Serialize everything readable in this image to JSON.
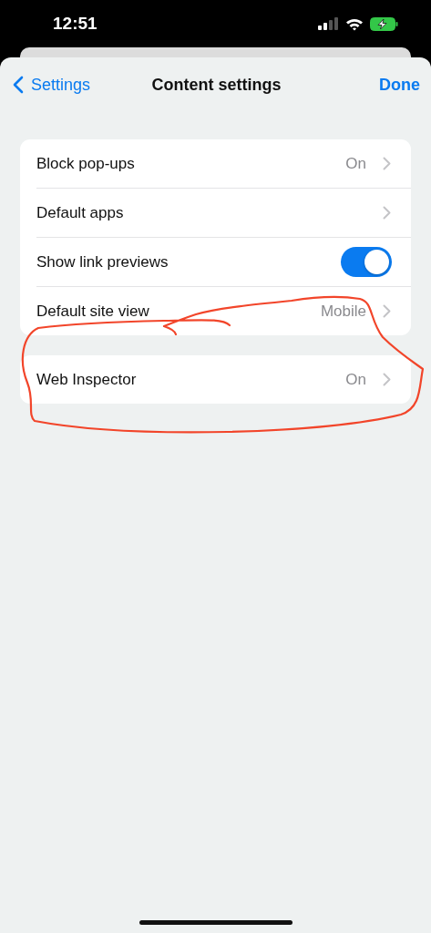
{
  "status_bar": {
    "time": "12:51"
  },
  "nav_bar": {
    "back": "Settings",
    "title": "Content settings",
    "done": "Done"
  },
  "groups": [
    {
      "rows": [
        {
          "kind": "nav",
          "label": "Block pop-ups",
          "value": "On"
        },
        {
          "kind": "nav",
          "label": "Default apps"
        },
        {
          "kind": "toggle",
          "label": "Show link previews",
          "on": true
        },
        {
          "kind": "nav",
          "label": "Default site view",
          "value": "Mobile"
        }
      ]
    },
    {
      "rows": [
        {
          "kind": "nav",
          "label": "Web Inspector",
          "value": "On"
        }
      ]
    }
  ]
}
